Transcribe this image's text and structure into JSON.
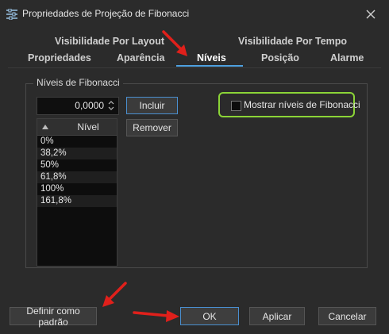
{
  "window": {
    "title": "Propriedades de Projeção de Fibonacci",
    "close_glyph": "✕"
  },
  "tabs": [
    {
      "label": "Visibilidade Por Layout",
      "active": false
    },
    {
      "label": "Visibilidade Por Tempo",
      "active": false
    },
    {
      "label": "Propriedades",
      "active": false
    },
    {
      "label": "Aparência",
      "active": false
    },
    {
      "label": "Níveis",
      "active": true
    },
    {
      "label": "Posição",
      "active": false
    },
    {
      "label": "Alarme",
      "active": false
    }
  ],
  "levels_group": {
    "title": "Níveis de Fibonacci",
    "input_value": "0,0000",
    "add_label": "Incluir",
    "remove_label": "Remover",
    "list_header": "Nível",
    "levels": [
      "0%",
      "38,2%",
      "50%",
      "61,8%",
      "100%",
      "161,8%"
    ]
  },
  "show_levels": {
    "label": "Mostrar níveis de Fibonacci",
    "checked": false
  },
  "footer": {
    "default_label": "Definir como padrão",
    "ok_label": "OK",
    "apply_label": "Aplicar",
    "cancel_label": "Cancelar"
  },
  "colors": {
    "accent": "#4ea1e0",
    "highlight": "#8bd437",
    "annotation": "#e0201b"
  }
}
